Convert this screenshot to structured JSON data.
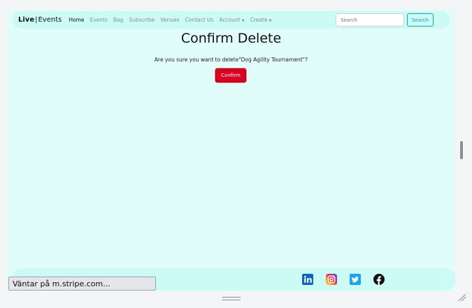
{
  "navbar": {
    "brand_bold": "Live",
    "brand_bar": "|",
    "brand_light": "Events",
    "links": [
      "Home",
      "Events",
      "Bag",
      "Subscribe",
      "Venues",
      "Contact Us",
      "Account",
      "Create"
    ],
    "search_placeholder": "Search",
    "search_button": "Search"
  },
  "main": {
    "title": "Confirm Delete",
    "prompt": "Are you sure you want to delete\"Dog Agility Tournament\"?",
    "confirm_button": "Confirm"
  },
  "footer": {
    "social_icons": [
      "linkedin-icon",
      "instagram-icon",
      "twitter-icon",
      "facebook-icon"
    ]
  },
  "status": {
    "text": "Väntar på m.stripe.com..."
  },
  "colors": {
    "page_bg": "#e1fdf9",
    "nav_bg": "#ccfbf5",
    "confirm": "#dc0025",
    "search_accent": "#17a2b8"
  }
}
